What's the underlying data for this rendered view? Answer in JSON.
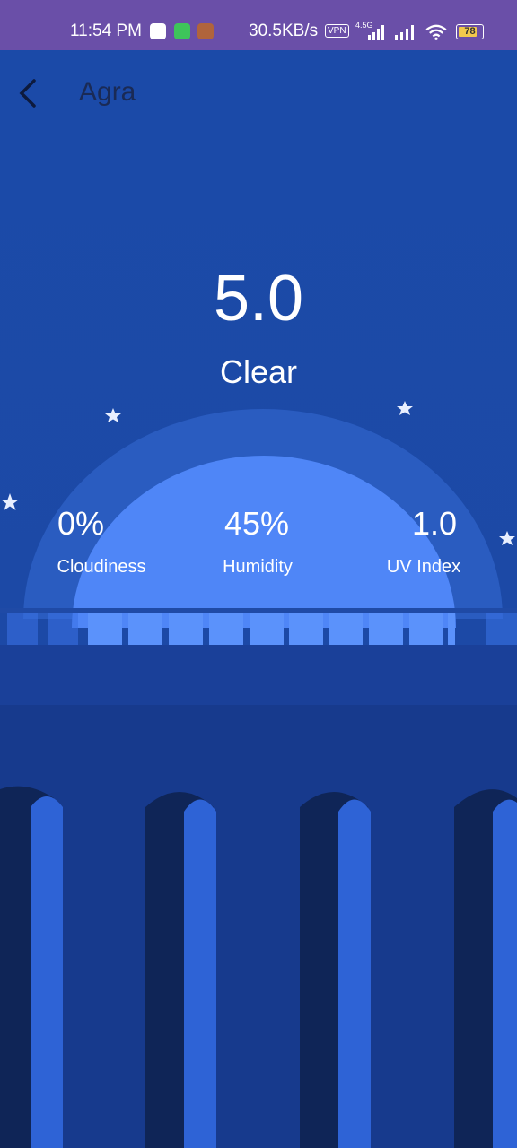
{
  "status_bar": {
    "time": "11:54 PM",
    "network_speed": "30.5KB/s",
    "vpn_label": "VPN",
    "network_type": "4.5G",
    "battery_level": "78"
  },
  "header": {
    "back_icon": "chevron-left-icon",
    "city": "Agra"
  },
  "weather": {
    "temperature": "5.0",
    "condition": "Clear"
  },
  "stats": [
    {
      "value": "0%",
      "label": "Cloudiness"
    },
    {
      "value": "45%",
      "label": "Humidity"
    },
    {
      "value": "1.0",
      "label": "UV Index"
    }
  ],
  "colors": {
    "status_bar": "#6a4fa8",
    "sky": "#1b4aa8",
    "sun": "#4f86f7",
    "halo": "#2a5cc0",
    "pillar_light": "#2e63d6",
    "pillar_dark": "#0f2557"
  }
}
